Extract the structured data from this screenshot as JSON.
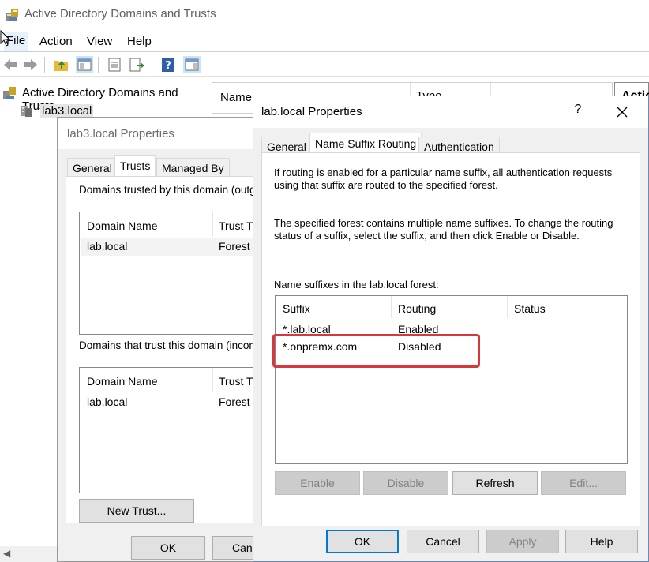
{
  "app": {
    "title": "Active Directory Domains and Trusts",
    "menu": [
      "File",
      "Action",
      "View",
      "Help"
    ]
  },
  "tree": {
    "root": "Active Directory Domains and Trusts",
    "child": "lab3.local"
  },
  "list": {
    "col_name": "Name",
    "col_type": "Type"
  },
  "actions": {
    "header": "Actio"
  },
  "back_dialog": {
    "title": "lab3.local Properties",
    "tabs": [
      "General",
      "Trusts",
      "Managed By"
    ],
    "outgoing_label": "Domains trusted by this domain (outgo",
    "incoming_label": "Domains that trust this domain (incom",
    "col_domain": "Domain Name",
    "col_trust": "Trust Ty",
    "outgoing_rows": [
      {
        "domain": "lab.local",
        "trust": "Forest"
      }
    ],
    "incoming_rows": [
      {
        "domain": "lab.local",
        "trust": "Forest"
      }
    ],
    "new_trust": "New Trust...",
    "ok": "OK",
    "cancel": "Canc"
  },
  "front_dialog": {
    "title": "lab.local Properties",
    "help_glyph": "?",
    "tabs": [
      "General",
      "Name Suffix Routing",
      "Authentication"
    ],
    "para1_line1": "If routing is enabled for a particular name suffix, all authentication requests",
    "para1_line2": "using that suffix are routed to the specified forest.",
    "para2_line1": "The specified forest contains multiple name suffixes. To change the routing",
    "para2_line2": "status of a suffix, select the suffix, and then click Enable or Disable.",
    "list_label": "Name suffixes in the lab.local forest:",
    "columns": [
      "Suffix",
      "Routing",
      "Status"
    ],
    "rows": [
      {
        "suffix": "*.lab.local",
        "routing": "Enabled",
        "status": ""
      },
      {
        "suffix": "*.onpremx.com",
        "routing": "Disabled",
        "status": ""
      }
    ],
    "enable": "Enable",
    "disable": "Disable",
    "refresh": "Refresh",
    "edit": "Edit...",
    "ok": "OK",
    "cancel": "Cancel",
    "apply": "Apply",
    "help": "Help"
  },
  "colors": {
    "highlight": "#d9363e",
    "accent": "#0078d7"
  }
}
